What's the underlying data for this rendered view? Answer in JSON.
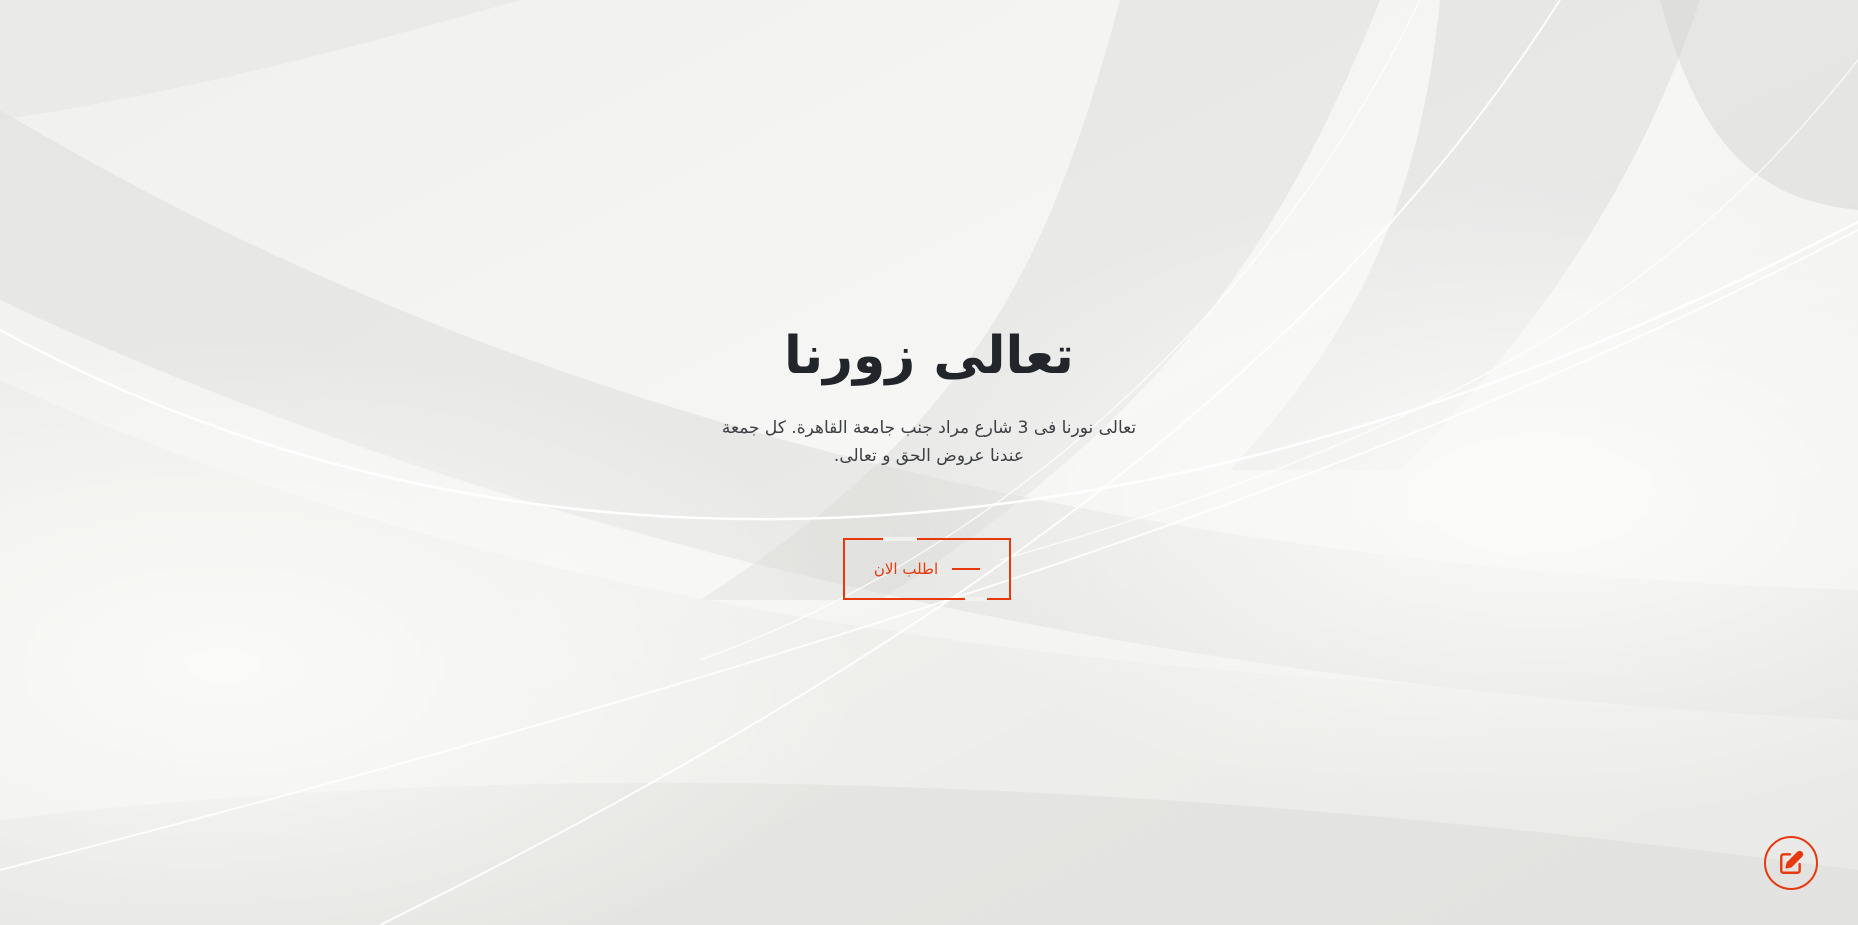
{
  "hero": {
    "title": "تعالى زورنا",
    "description": "تعالى نورنا فى 3 شارع مراد جنب جامعة القاهرة. كل جمعة عندنا عروض الحق و تعالى.",
    "cta_label": "اطلب الان"
  },
  "floating": {
    "edit_icon": "edit-icon"
  },
  "colors": {
    "accent": "#e8380d",
    "heading": "#22262b",
    "body_text": "#3c3f44",
    "background": "#f1f1ef"
  }
}
